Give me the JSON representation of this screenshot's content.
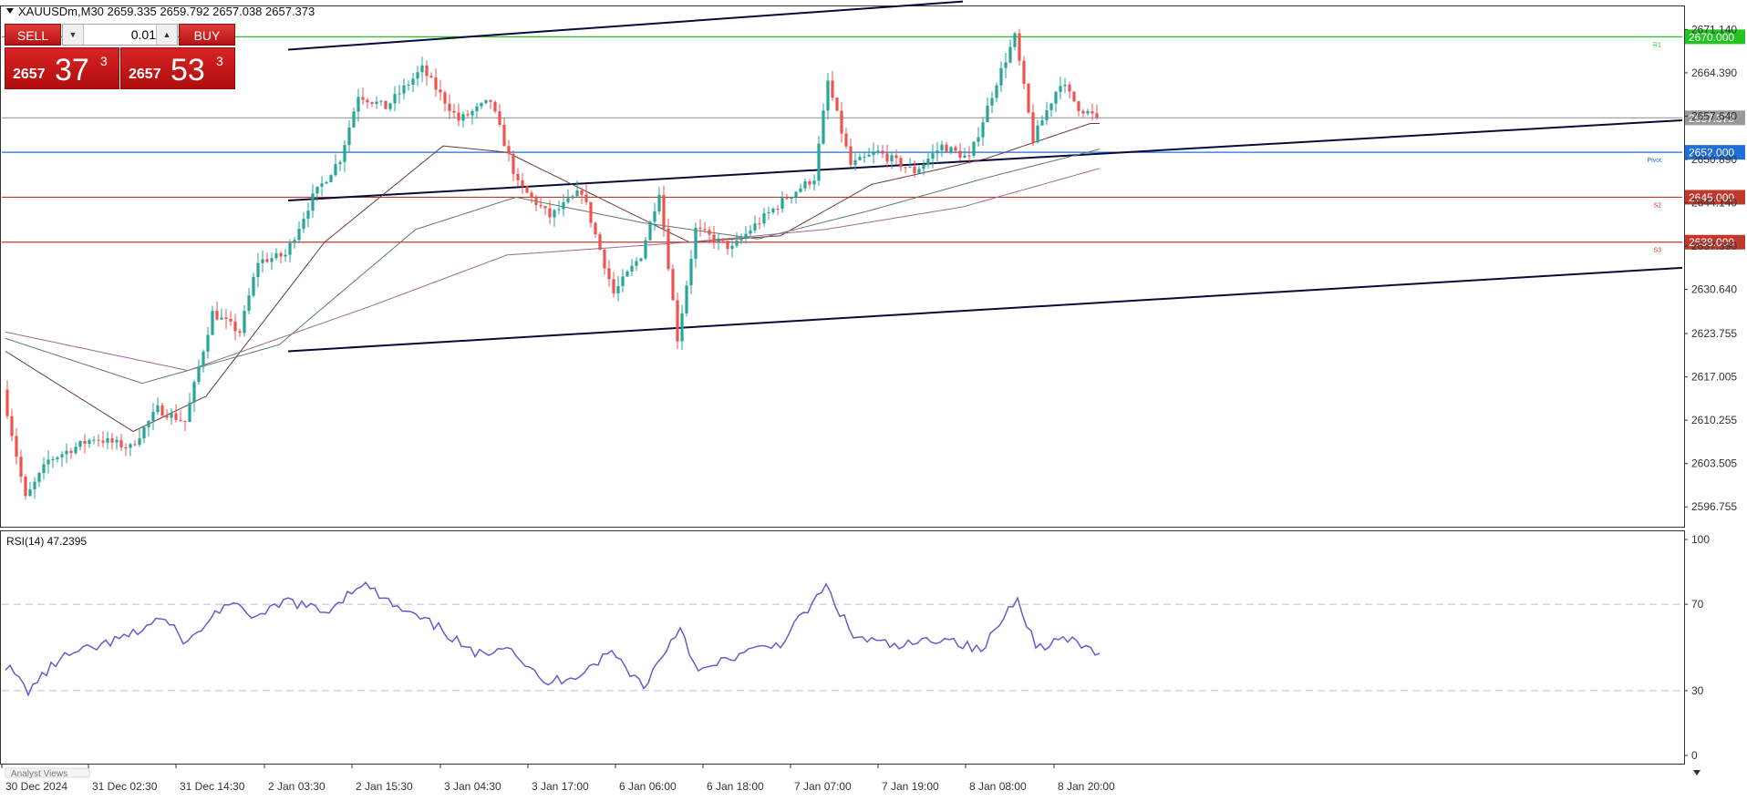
{
  "header": {
    "symbol_info": "XAUUSDm,M30  2659.335 2659.792 2657.038 2657.373"
  },
  "trade_panel": {
    "sell_label": "SELL",
    "buy_label": "BUY",
    "lot_value": "0.01",
    "sell_price_small": "2657",
    "sell_price_big": "37",
    "sell_price_sup": "3",
    "buy_price_small": "2657",
    "buy_price_big": "53",
    "buy_price_sup": "3"
  },
  "colors": {
    "bull_candle": "#26a69a",
    "bear_candle": "#ef5350",
    "trendline": "#0a0a3a",
    "r1_line": "#22c322",
    "pivot_line": "#1e6fd9",
    "support_line": "#c0392b",
    "rsi_line": "#6a5acd",
    "ma_fast": "#6b3a3a",
    "ma_mid": "#5a7a6a",
    "ma_slow": "#9a6a9a"
  },
  "chart_data": {
    "type": "candlestick",
    "symbol": "XAUUSDm",
    "timeframe": "M30",
    "last_price": 2657.373,
    "ylim": [
      2593.8,
      2674.6
    ],
    "y_ticks": [
      2671.14,
      2664.39,
      2657.64,
      2650.89,
      2644.14,
      2637.39,
      2630.64,
      2623.755,
      2617.005,
      2610.255,
      2603.505,
      2596.755
    ],
    "y_tick_labels": [
      "2671.140",
      "2664.390",
      "2657.640",
      "2650.890",
      "2644.140",
      "2637.390",
      "2630.640",
      "2623.755",
      "2617.005",
      "2610.255",
      "2603.505",
      "2596.755"
    ],
    "x_labels": [
      "30 Dec 2024",
      "31 Dec 02:30",
      "31 Dec 14:30",
      "2 Jan 03:30",
      "2 Jan 15:30",
      "3 Jan 04:30",
      "3 Jan 17:00",
      "6 Jan 06:00",
      "6 Jan 18:00",
      "7 Jan 07:00",
      "7 Jan 19:00",
      "8 Jan 08:00",
      "8 Jan 20:00"
    ],
    "bar_count": 240,
    "keypoints": [
      [
        0,
        2615.0
      ],
      [
        5,
        2598.0
      ],
      [
        10,
        2604.0
      ],
      [
        20,
        2607.5
      ],
      [
        28,
        2606.0
      ],
      [
        34,
        2612.0
      ],
      [
        40,
        2610.0
      ],
      [
        46,
        2627.0
      ],
      [
        52,
        2624.0
      ],
      [
        56,
        2635.0
      ],
      [
        62,
        2636.0
      ],
      [
        68,
        2645.0
      ],
      [
        74,
        2651.0
      ],
      [
        78,
        2661.0
      ],
      [
        84,
        2659.0
      ],
      [
        92,
        2665.0
      ],
      [
        100,
        2657.0
      ],
      [
        107,
        2660.0
      ],
      [
        113,
        2647.0
      ],
      [
        120,
        2642.0
      ],
      [
        127,
        2646.0
      ],
      [
        134,
        2630.0
      ],
      [
        140,
        2636.0
      ],
      [
        144,
        2646.0
      ],
      [
        148,
        2623.0
      ],
      [
        152,
        2640.0
      ],
      [
        160,
        2637.0
      ],
      [
        164,
        2640.0
      ],
      [
        172,
        2645.0
      ],
      [
        178,
        2648.0
      ],
      [
        181,
        2663.0
      ],
      [
        186,
        2650.0
      ],
      [
        192,
        2652.0
      ],
      [
        200,
        2649.0
      ],
      [
        206,
        2653.0
      ],
      [
        212,
        2651.0
      ],
      [
        218,
        2663.0
      ],
      [
        222,
        2670.0
      ],
      [
        226,
        2654.0
      ],
      [
        232,
        2663.0
      ],
      [
        236,
        2659.0
      ],
      [
        240,
        2657.373
      ]
    ],
    "horizontal_levels": [
      {
        "label": "2670.000",
        "value": 2670.0,
        "marker": "R1",
        "color": "#22c322"
      },
      {
        "label": "2657.373",
        "value": 2657.373,
        "color": "#999999"
      },
      {
        "label": "2652.000",
        "value": 2652.0,
        "marker": "Pivot",
        "color": "#1e6fd9"
      },
      {
        "label": "2645.000",
        "value": 2645.0,
        "marker": "S2",
        "color": "#c0392b"
      },
      {
        "label": "2638.000",
        "value": 2638.0,
        "marker": "S3",
        "color": "#c0392b"
      }
    ],
    "trendlines": [
      {
        "from": [
          62,
          2668.0
        ],
        "to": [
          210,
          2675.5
        ]
      },
      {
        "from": [
          62,
          2644.5
        ],
        "to": [
          368,
          2657.0
        ]
      },
      {
        "from": [
          62,
          2621.0
        ],
        "to": [
          368,
          2634.0
        ]
      }
    ],
    "moving_averages": [
      {
        "keypoints": [
          [
            0,
            2621.0
          ],
          [
            28,
            2608.5
          ],
          [
            44,
            2614.0
          ],
          [
            70,
            2638.0
          ],
          [
            96,
            2653.0
          ],
          [
            110,
            2652.0
          ],
          [
            130,
            2645.0
          ],
          [
            150,
            2638.0
          ],
          [
            170,
            2639.0
          ],
          [
            190,
            2647.0
          ],
          [
            215,
            2651.0
          ],
          [
            238,
            2656.5
          ]
        ],
        "color": "#6b3a3a"
      },
      {
        "keypoints": [
          [
            0,
            2623.0
          ],
          [
            30,
            2616.0
          ],
          [
            60,
            2622.0
          ],
          [
            90,
            2640.0
          ],
          [
            112,
            2645.0
          ],
          [
            140,
            2641.0
          ],
          [
            165,
            2638.5
          ],
          [
            190,
            2643.0
          ],
          [
            215,
            2648.0
          ],
          [
            240,
            2652.5
          ]
        ],
        "color": "#5a7a6a"
      },
      {
        "keypoints": [
          [
            0,
            2624.0
          ],
          [
            40,
            2618.0
          ],
          [
            80,
            2628.0
          ],
          [
            110,
            2636.0
          ],
          [
            150,
            2638.0
          ],
          [
            180,
            2640.0
          ],
          [
            210,
            2643.5
          ],
          [
            240,
            2649.5
          ]
        ],
        "color": "#9a6a9a"
      }
    ],
    "indicator": {
      "label": "RSI(14) 47.2395",
      "ylim": [
        0,
        100
      ],
      "levels": [
        30,
        70
      ],
      "y_tick_labels": [
        "100",
        "70",
        "30",
        "0"
      ],
      "y_ticks": [
        100,
        70,
        30,
        0
      ],
      "keypoints": [
        [
          0,
          42
        ],
        [
          5,
          30
        ],
        [
          12,
          45
        ],
        [
          20,
          50
        ],
        [
          28,
          56
        ],
        [
          34,
          64
        ],
        [
          40,
          52
        ],
        [
          48,
          70
        ],
        [
          56,
          64
        ],
        [
          62,
          72
        ],
        [
          70,
          66
        ],
        [
          78,
          80
        ],
        [
          86,
          68
        ],
        [
          96,
          58
        ],
        [
          103,
          46
        ],
        [
          110,
          52
        ],
        [
          118,
          33
        ],
        [
          126,
          38
        ],
        [
          133,
          48
        ],
        [
          140,
          32
        ],
        [
          148,
          60
        ],
        [
          152,
          38
        ],
        [
          160,
          46
        ],
        [
          170,
          52
        ],
        [
          180,
          78
        ],
        [
          186,
          55
        ],
        [
          196,
          50
        ],
        [
          206,
          55
        ],
        [
          214,
          48
        ],
        [
          222,
          74
        ],
        [
          226,
          50
        ],
        [
          232,
          54
        ],
        [
          240,
          47.24
        ]
      ]
    }
  },
  "footer": {
    "tab_label": "Analyst Views"
  }
}
